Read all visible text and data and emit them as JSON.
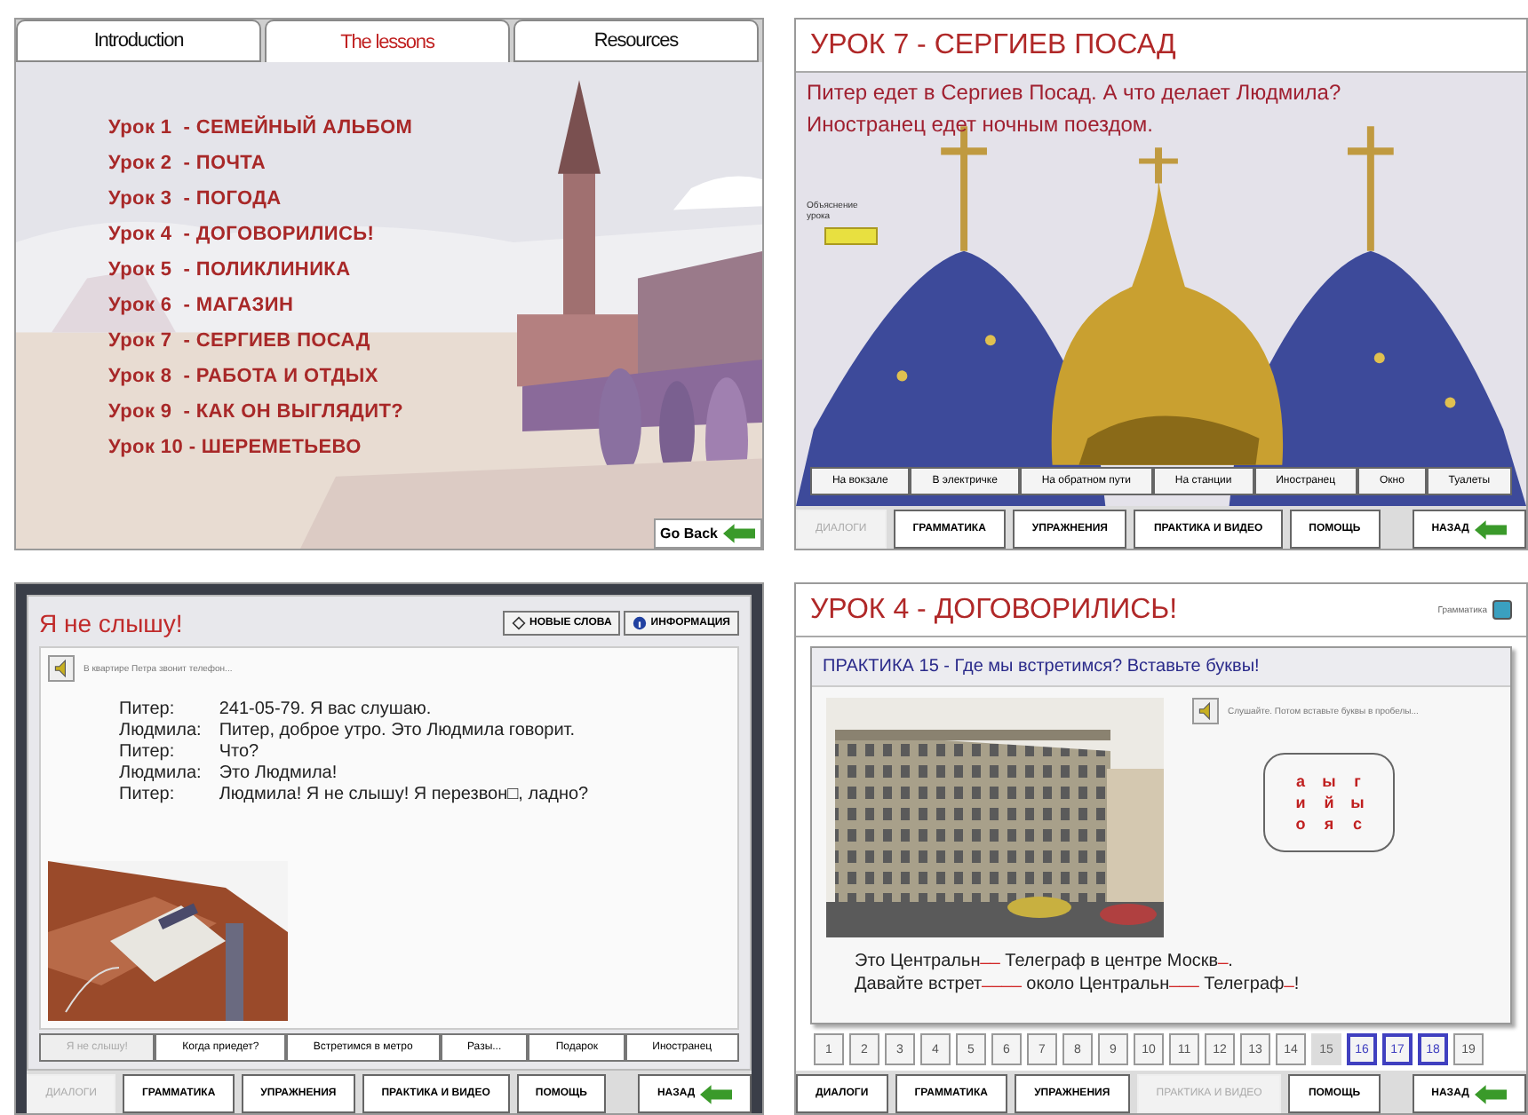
{
  "lessons_menu": {
    "tabs": [
      {
        "label": "Introduction",
        "selected": false
      },
      {
        "label": "The lessons",
        "selected": true
      },
      {
        "label": "Resources",
        "selected": false
      }
    ],
    "lessons": [
      "Урок 1  - СЕМЕЙНЫЙ АЛЬБОМ",
      "Урок 2  - ПОЧТА",
      "Урок 3  - ПОГОДА",
      "Урок 4  - ДОГОВОРИЛИСЬ!",
      "Урок 5  - ПОЛИКЛИНИКА",
      "Урок 6  - МАГАЗИН",
      "Урок 7  - СЕРГИЕВ ПОСАД",
      "Урок 8  - РАБОТА И ОТДЫХ",
      "Урок 9  - КАК ОН ВЫГЛЯДИТ?",
      "Урок 10 - ШЕРЕМЕТЬЕВО"
    ],
    "back_button": "Go Back"
  },
  "lesson_7": {
    "title": "УРОК 7 - СЕРГИЕВ ПОСАД",
    "intro": [
      "Питер едет в Сергиев Посад. А что делает Людмила?",
      "Иностранец едет ночным поездом."
    ],
    "explanation_label": "Объяснение урока",
    "scenes": [
      "На вокзале",
      "В электричке",
      "На обратном пути",
      "На станции",
      "Иностранец",
      "Окно",
      "Туалеты"
    ],
    "nav": [
      {
        "label": "ДИАЛОГИ",
        "selected": true
      },
      {
        "label": "ГРАММАТИКА",
        "selected": false
      },
      {
        "label": "УПРАЖНЕНИЯ",
        "selected": false
      },
      {
        "label": "ПРАКТИКА И ВИДЕО",
        "selected": false
      },
      {
        "label": "ПОМОЩЬ",
        "selected": false
      }
    ],
    "back_button": "НАЗАД"
  },
  "dialogue": {
    "title": "Я не слышу!",
    "buttons": [
      "НОВЫЕ СЛОВА",
      "ИНФОРМАЦИЯ"
    ],
    "caption": "В квартире Петра звонит телефон...",
    "lines": [
      {
        "speaker": "Питер:",
        "text": "241-05-79. Я вас слушаю."
      },
      {
        "speaker": "Людмила:",
        "text": "Питер, доброе утро. Это Людмила говорит."
      },
      {
        "speaker": "Питер:",
        "text": "Что?"
      },
      {
        "speaker": "Людмила:",
        "text": "Это Людмила!"
      },
      {
        "speaker": "Питер:",
        "text": "Людмила! Я не слышу! Я перезвон□, ладно?"
      }
    ],
    "scenes": [
      {
        "label": "Я не слышу!",
        "selected": true
      },
      {
        "label": "Когда приедет?",
        "selected": false
      },
      {
        "label": "Встретимся в метро",
        "selected": false
      },
      {
        "label": "Разы...",
        "selected": false
      },
      {
        "label": "Подарок",
        "selected": false
      },
      {
        "label": "Иностранец",
        "selected": false
      }
    ],
    "nav": [
      {
        "label": "ДИАЛОГИ",
        "selected": true
      },
      {
        "label": "ГРАММАТИКА",
        "selected": false
      },
      {
        "label": "УПРАЖНЕНИЯ",
        "selected": false
      },
      {
        "label": "ПРАКТИКА И ВИДЕО",
        "selected": false
      },
      {
        "label": "ПОМОЩЬ",
        "selected": false
      }
    ],
    "back_button": "НАЗАД"
  },
  "practice": {
    "title": "УРОК 4 - ДОГОВОРИЛИСЬ!",
    "grammar_link": "Грамматика",
    "heading": "ПРАКТИКА 15  - Где мы встретимся? Вставьте буквы!",
    "caption": "Слушайте. Потом вставьте буквы в пробелы...",
    "letters": [
      "а",
      "ы",
      "г",
      "и",
      "й",
      "ы",
      "о",
      "я",
      "с"
    ],
    "sentences": [
      [
        {
          "kind": "text",
          "text": "Это Центральн"
        },
        {
          "kind": "blank",
          "text": "__"
        },
        {
          "kind": "text",
          "text": " Телеграф в центре Москв"
        },
        {
          "kind": "blank",
          "text": "_"
        },
        {
          "kind": "text",
          "text": "."
        }
      ],
      [
        {
          "kind": "text",
          "text": "Давайте встрет"
        },
        {
          "kind": "blank",
          "text": "____"
        },
        {
          "kind": "text",
          "text": " около Центральн"
        },
        {
          "kind": "blank",
          "text": "___"
        },
        {
          "kind": "text",
          "text": " Телеграф"
        },
        {
          "kind": "blank",
          "text": "_"
        },
        {
          "kind": "text",
          "text": "!"
        }
      ]
    ],
    "pages": [
      {
        "label": "1",
        "selected": false,
        "marked": false
      },
      {
        "label": "2",
        "selected": false,
        "marked": false
      },
      {
        "label": "3",
        "selected": false,
        "marked": false
      },
      {
        "label": "4",
        "selected": false,
        "marked": false
      },
      {
        "label": "5",
        "selected": false,
        "marked": false
      },
      {
        "label": "6",
        "selected": false,
        "marked": false
      },
      {
        "label": "7",
        "selected": false,
        "marked": false
      },
      {
        "label": "8",
        "selected": false,
        "marked": false
      },
      {
        "label": "9",
        "selected": false,
        "marked": false
      },
      {
        "label": "10",
        "selected": false,
        "marked": false
      },
      {
        "label": "11",
        "selected": false,
        "marked": false
      },
      {
        "label": "12",
        "selected": false,
        "marked": false
      },
      {
        "label": "13",
        "selected": false,
        "marked": false
      },
      {
        "label": "14",
        "selected": false,
        "marked": false
      },
      {
        "label": "15",
        "selected": true,
        "marked": false
      },
      {
        "label": "16",
        "selected": false,
        "marked": true
      },
      {
        "label": "17",
        "selected": false,
        "marked": true
      },
      {
        "label": "18",
        "selected": false,
        "marked": true
      },
      {
        "label": "19",
        "selected": false,
        "marked": false
      }
    ],
    "nav": [
      {
        "label": "ДИАЛОГИ",
        "selected": false
      },
      {
        "label": "ГРАММАТИКА",
        "selected": false
      },
      {
        "label": "УПРАЖНЕНИЯ",
        "selected": false
      },
      {
        "label": "ПРАКТИКА И ВИДЕО",
        "selected": true
      },
      {
        "label": "ПОМОЩЬ",
        "selected": false
      }
    ],
    "back_button": "НАЗАД"
  }
}
